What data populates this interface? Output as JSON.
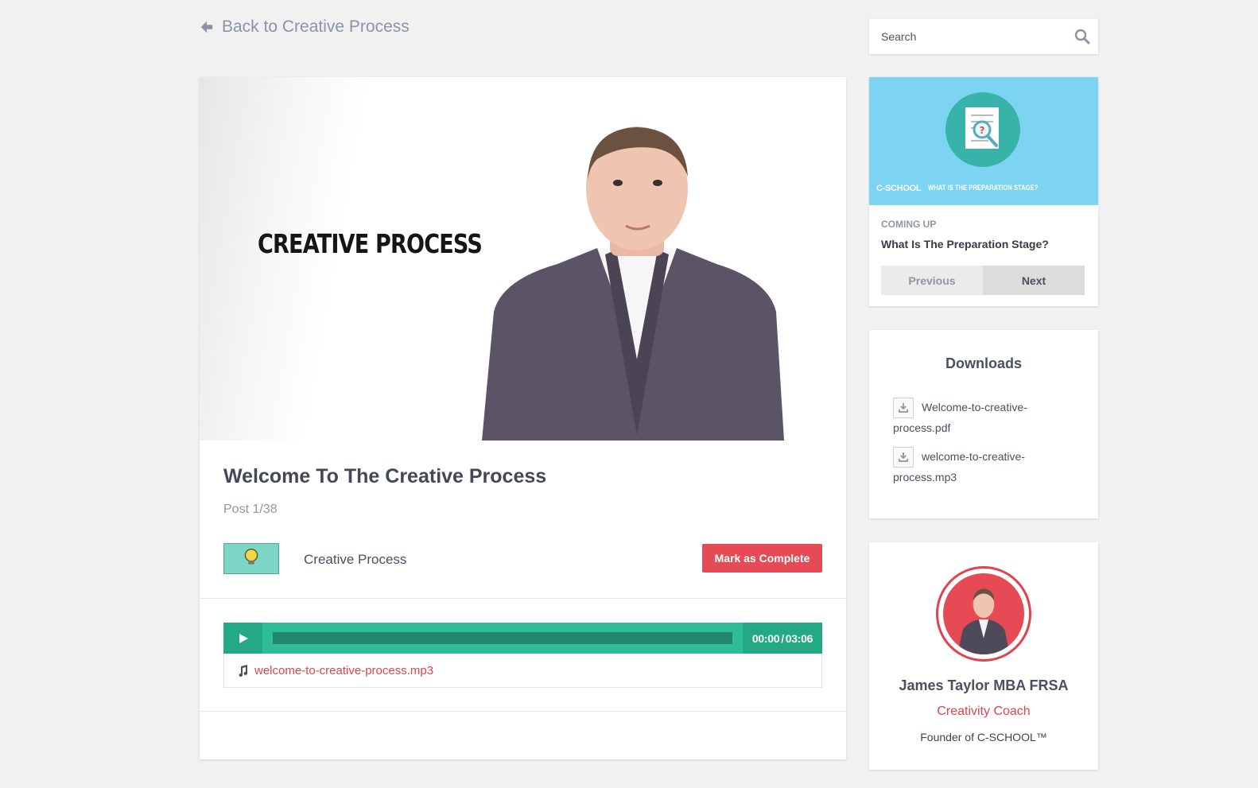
{
  "nav": {
    "back_label": "Back to Creative Process",
    "back_icon": "arrow-left-icon"
  },
  "video": {
    "overlay_title": "CREATIVE PROCESS"
  },
  "lesson": {
    "title": "Welcome To The Creative Process",
    "post_count": "Post 1/38",
    "course_name": "Creative Process",
    "complete_label": "Mark as Complete"
  },
  "audio": {
    "current_time": "00:00",
    "separator": "/",
    "duration": "03:06",
    "progress": 0,
    "file_name": "welcome-to-creative-process.mp3"
  },
  "search": {
    "placeholder": "Search",
    "value": ""
  },
  "up_next": {
    "thumb_brand": "C-SCHOOL",
    "thumb_caption": "WHAT IS THE PREPARATION STAGE?",
    "label": "COMING UP",
    "title": "What Is The Preparation Stage?",
    "previous_label": "Previous",
    "next_label": "Next"
  },
  "downloads": {
    "title": "Downloads",
    "items": [
      {
        "name": "Welcome-to-creative-process.pdf"
      },
      {
        "name": "welcome-to-creative-process.mp3"
      }
    ]
  },
  "author": {
    "name": "James Taylor MBA FRSA",
    "role": "Creativity Coach",
    "note": "Founder of C-SCHOOL™"
  },
  "colors": {
    "accent_red": "#e64b55",
    "player_green": "#2fbd99",
    "player_dark": "#24a985",
    "thumb_blue": "#7dd3f2",
    "page_bg": "#f1f1f1"
  }
}
